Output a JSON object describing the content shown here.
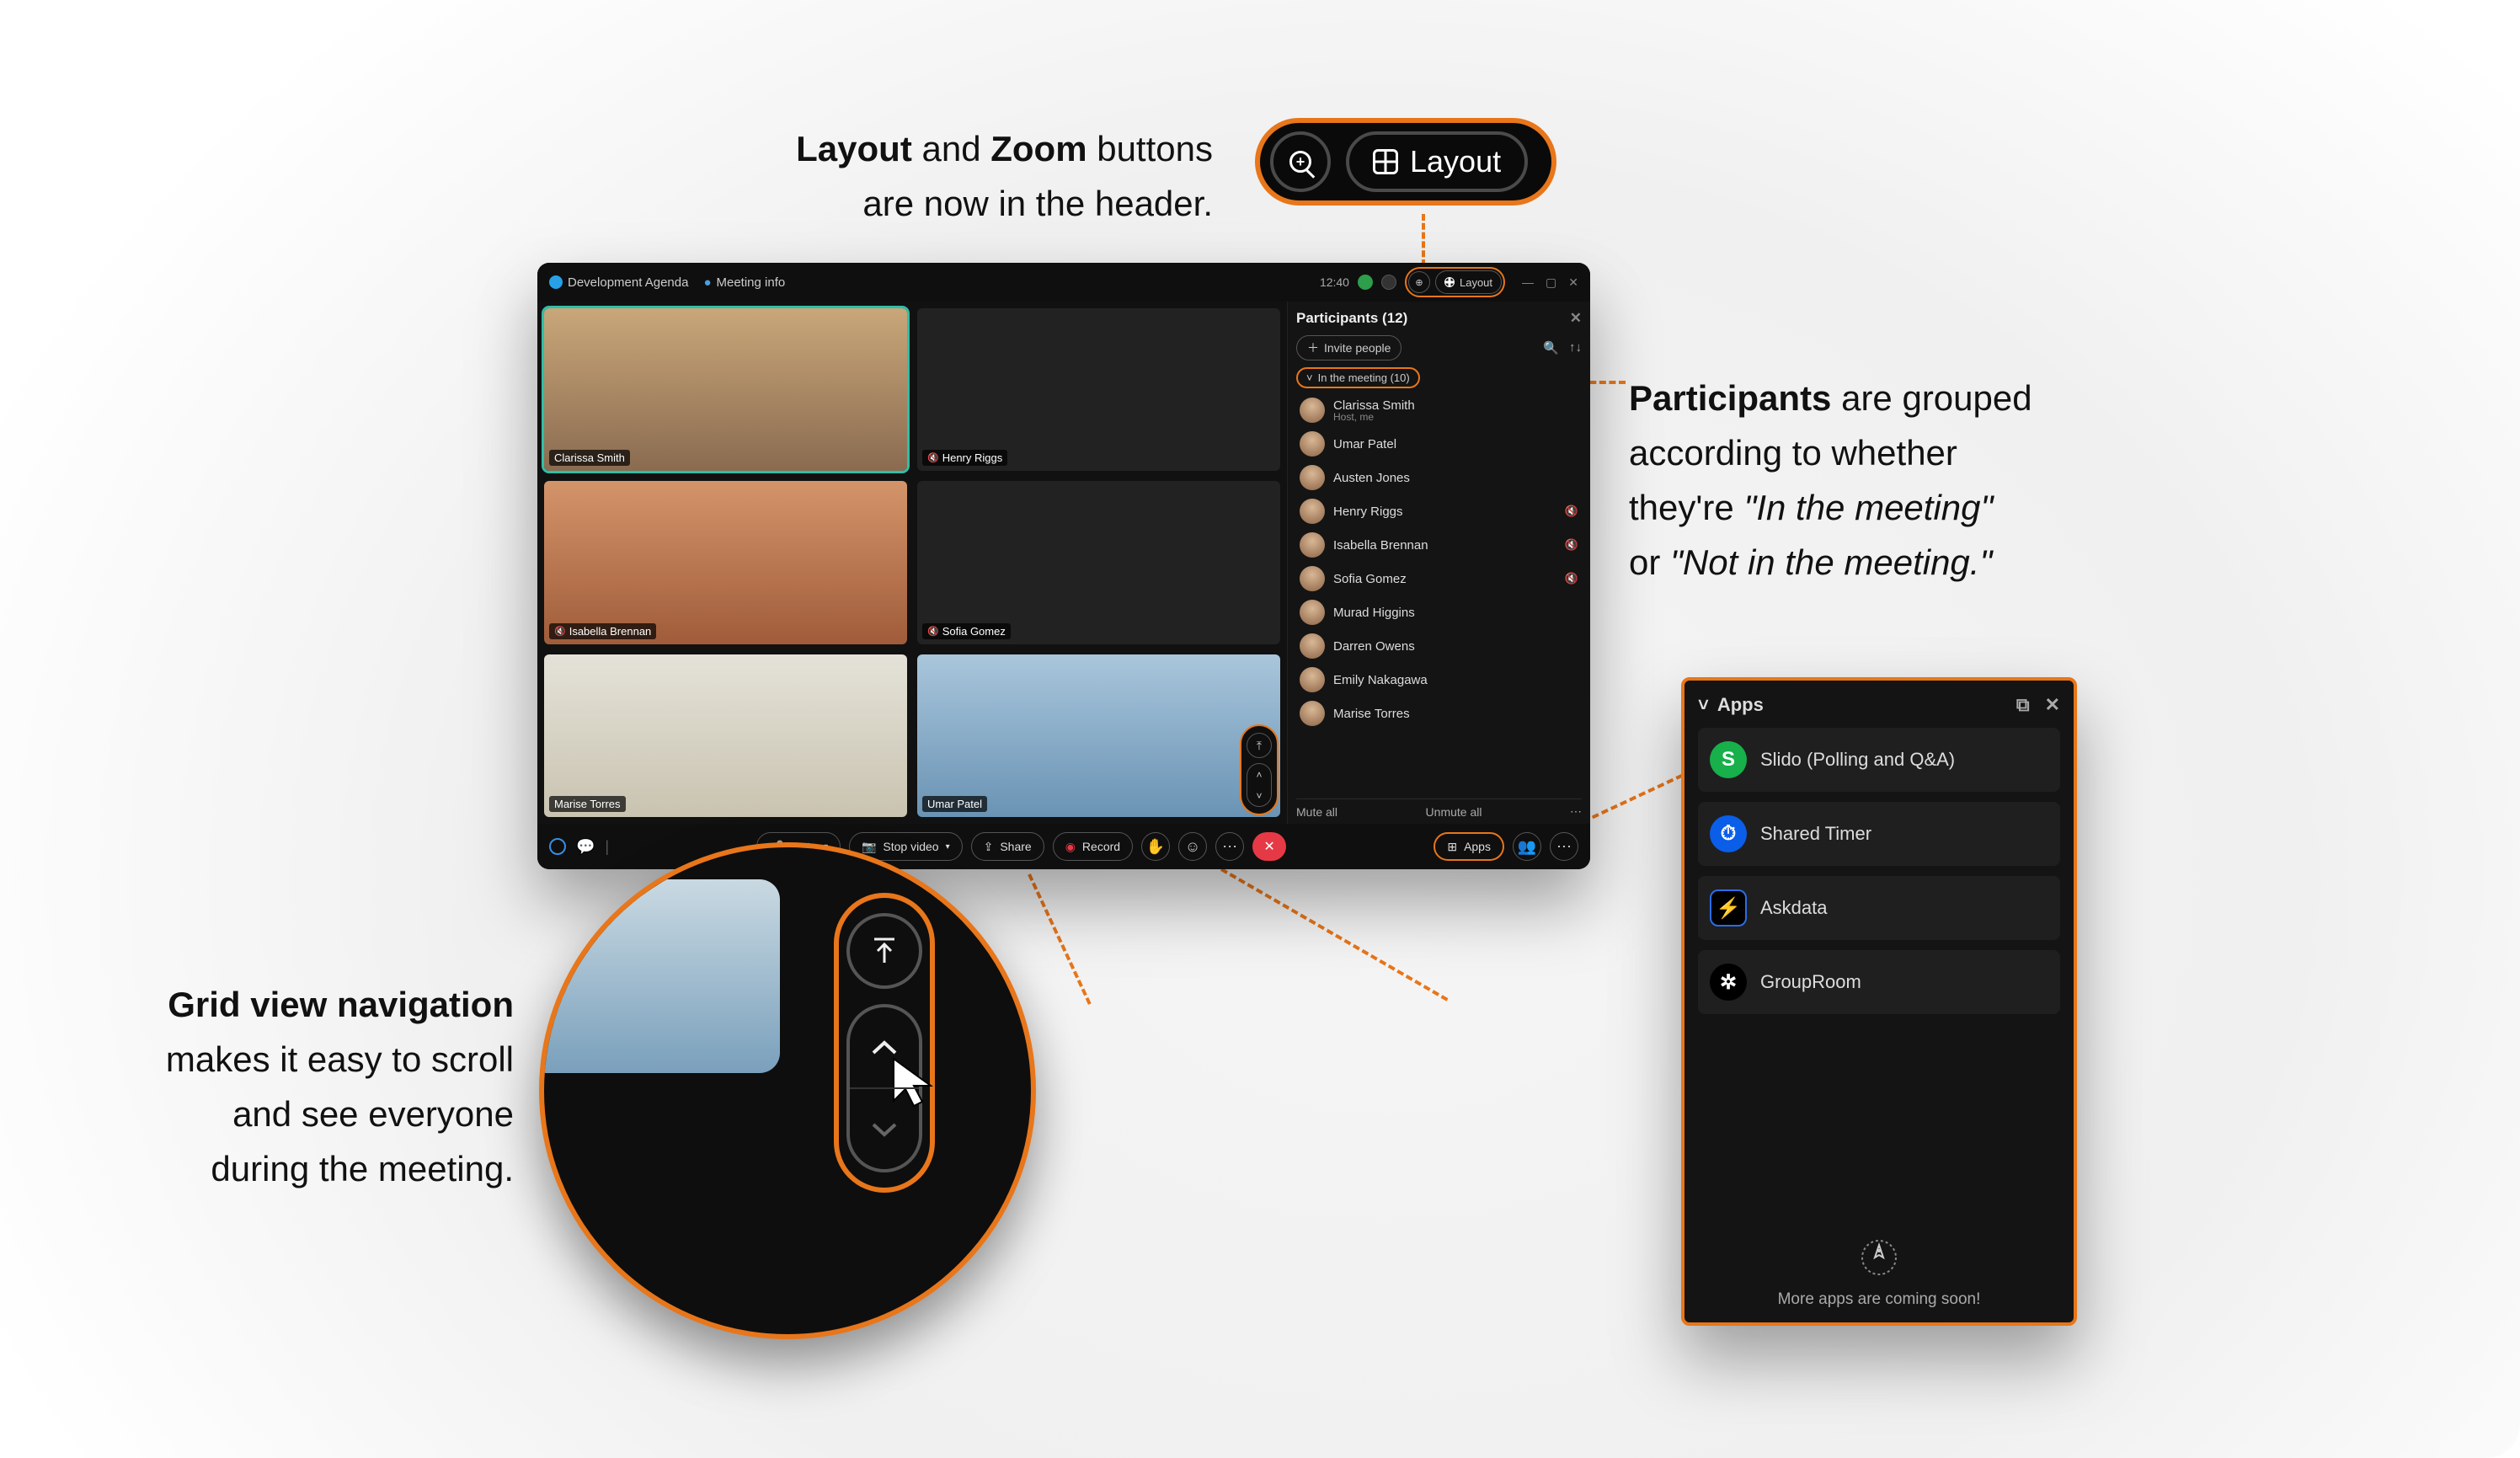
{
  "annotations": {
    "layout": {
      "line1_b1": "Layout",
      "line1_mid": " and ",
      "line1_b2": "Zoom",
      "line1_end": " buttons",
      "line2": "are now in the header."
    },
    "participants": {
      "b": "Participants",
      "l1_rest": " are grouped",
      "l2": "according to whether",
      "l3_a": "they're ",
      "l3_i": "\"In the meeting\"",
      "l4_a": "or ",
      "l4_i": "\"Not in the meeting.\""
    },
    "gridnav": {
      "b": "Grid view navigation",
      "l2": "makes it easy to scroll",
      "l3": "and see everyone",
      "l4": "during the meeting."
    }
  },
  "layout_pill": {
    "label": "Layout"
  },
  "app": {
    "header": {
      "agenda": "Development Agenda",
      "meeting_info": "Meeting info",
      "time": "12:40",
      "layout_label": "Layout"
    },
    "tiles": [
      {
        "name": "Clarissa Smith",
        "muted": false,
        "active": true,
        "avatar_only": false,
        "bg": "p1"
      },
      {
        "name": "Henry Riggs",
        "muted": true,
        "active": false,
        "avatar_only": true,
        "bg": "p2"
      },
      {
        "name": "Isabella Brennan",
        "muted": true,
        "active": false,
        "avatar_only": false,
        "bg": "p3"
      },
      {
        "name": "Sofia Gomez",
        "muted": true,
        "active": false,
        "avatar_only": true,
        "bg": "p4"
      },
      {
        "name": "Marise Torres",
        "muted": false,
        "active": false,
        "avatar_only": false,
        "bg": "p5"
      },
      {
        "name": "Umar Patel",
        "muted": false,
        "active": false,
        "avatar_only": false,
        "bg": "p6"
      }
    ],
    "participants": {
      "title": "Participants (12)",
      "invite": "Invite people",
      "group_label": "In the meeting (10)",
      "list": [
        {
          "name": "Clarissa Smith",
          "sub": "Host, me",
          "muted": false
        },
        {
          "name": "Umar Patel",
          "sub": "",
          "muted": false
        },
        {
          "name": "Austen Jones",
          "sub": "",
          "muted": false
        },
        {
          "name": "Henry Riggs",
          "sub": "",
          "muted": true
        },
        {
          "name": "Isabella Brennan",
          "sub": "",
          "muted": true
        },
        {
          "name": "Sofia Gomez",
          "sub": "",
          "muted": true
        },
        {
          "name": "Murad Higgins",
          "sub": "",
          "muted": false
        },
        {
          "name": "Darren Owens",
          "sub": "",
          "muted": false
        },
        {
          "name": "Emily Nakagawa",
          "sub": "",
          "muted": false
        },
        {
          "name": "Marise Torres",
          "sub": "",
          "muted": false
        }
      ],
      "mute_all": "Mute all",
      "unmute_all": "Unmute all"
    },
    "footer": {
      "mute": "Mute",
      "stopvideo": "Stop video",
      "share": "Share",
      "record": "Record",
      "apps": "Apps"
    }
  },
  "apps_panel": {
    "title": "Apps",
    "items": [
      {
        "name": "Slido (Polling and Q&A)",
        "icon": "S",
        "cls": "ico-slido"
      },
      {
        "name": "Shared Timer",
        "icon": "⏱",
        "cls": "ico-timer"
      },
      {
        "name": "Askdata",
        "icon": "⚡",
        "cls": "ico-ask"
      },
      {
        "name": "GroupRoom",
        "icon": "✲",
        "cls": "ico-group"
      }
    ],
    "footer": "More apps are coming soon!"
  }
}
